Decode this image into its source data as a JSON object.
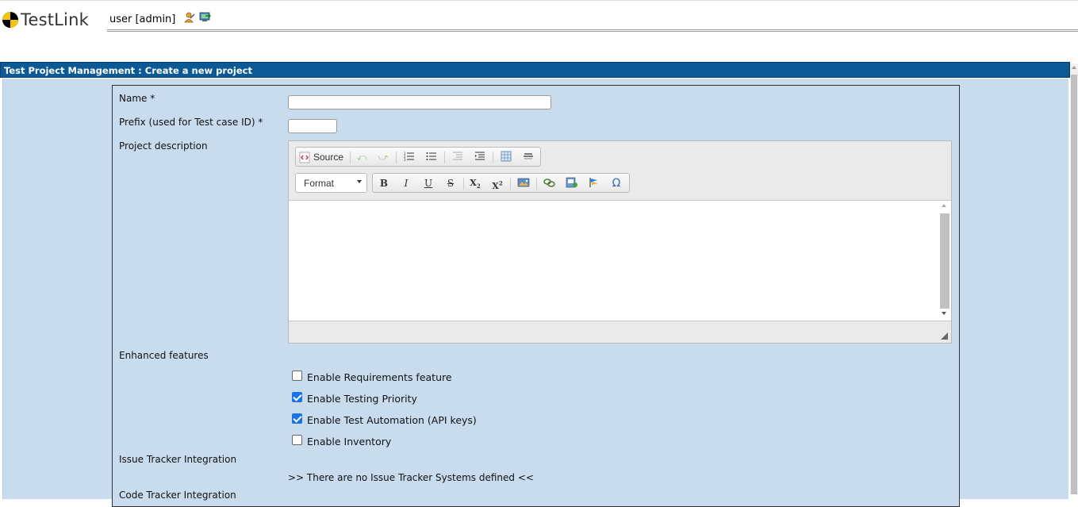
{
  "header": {
    "logo_text": "TestLink",
    "username": "user [admin]",
    "icons": [
      "user-settings-icon",
      "logout-icon"
    ]
  },
  "page_title": "Test Project Management : Create a new project",
  "form": {
    "name_label": "Name *",
    "name_value": "",
    "prefix_label": "Prefix (used for Test case ID) *",
    "prefix_value": "",
    "description_label": "Project description",
    "editor": {
      "source_label": "Source",
      "format_label": "Format",
      "content": ""
    },
    "enhanced_label": "Enhanced features",
    "features": [
      {
        "label": "Enable Requirements feature",
        "checked": false
      },
      {
        "label": "Enable Testing Priority",
        "checked": true
      },
      {
        "label": "Enable Test Automation (API keys)",
        "checked": true
      },
      {
        "label": "Enable Inventory",
        "checked": false
      }
    ],
    "issue_tracker_label": "Issue Tracker Integration",
    "issue_tracker_msg": ">> There are no Issue Tracker Systems defined <<",
    "code_tracker_label": "Code Tracker Integration"
  },
  "colors": {
    "title_bar": "#0b5a95",
    "content_bg": "#c8dcee",
    "checkbox_checked": "#1a73e8"
  }
}
